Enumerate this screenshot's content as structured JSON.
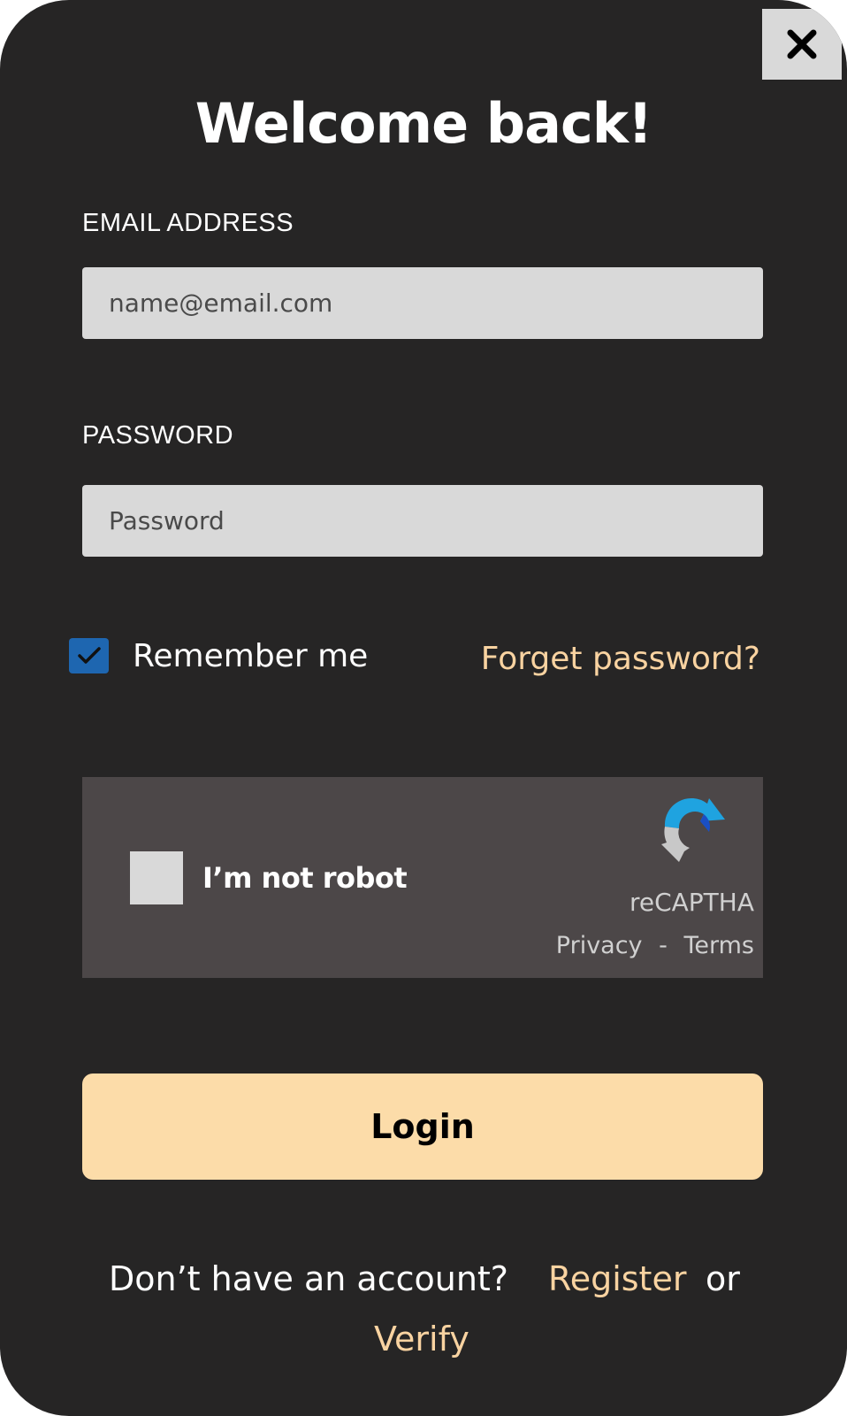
{
  "title": "Welcome back!",
  "close": {
    "icon": "close-icon"
  },
  "email": {
    "label": "EMAIL ADDRESS",
    "placeholder": "name@email.com",
    "value": ""
  },
  "password": {
    "label": "PASSWORD",
    "placeholder": "Password",
    "value": ""
  },
  "remember": {
    "label": "Remember me",
    "checked": true,
    "icon": "checkmark-icon"
  },
  "forgot_link": "Forget password?",
  "captcha": {
    "label": "I’m not robot",
    "brand": "reCAPTHA",
    "privacy": "Privacy",
    "separator": "-",
    "terms": "Terms",
    "logo_icon": "recaptcha-logo-icon"
  },
  "login_button": "Login",
  "footer": {
    "question": "Don’t have an account?",
    "register": "Register",
    "or": "or",
    "verify": "Verify"
  },
  "colors": {
    "background": "#262525",
    "accent": "#f9d3a1",
    "button": "#fcdca9",
    "checkbox": "#1e66b0",
    "field": "#d9d9d9",
    "captcha_bg": "#4c4748"
  }
}
